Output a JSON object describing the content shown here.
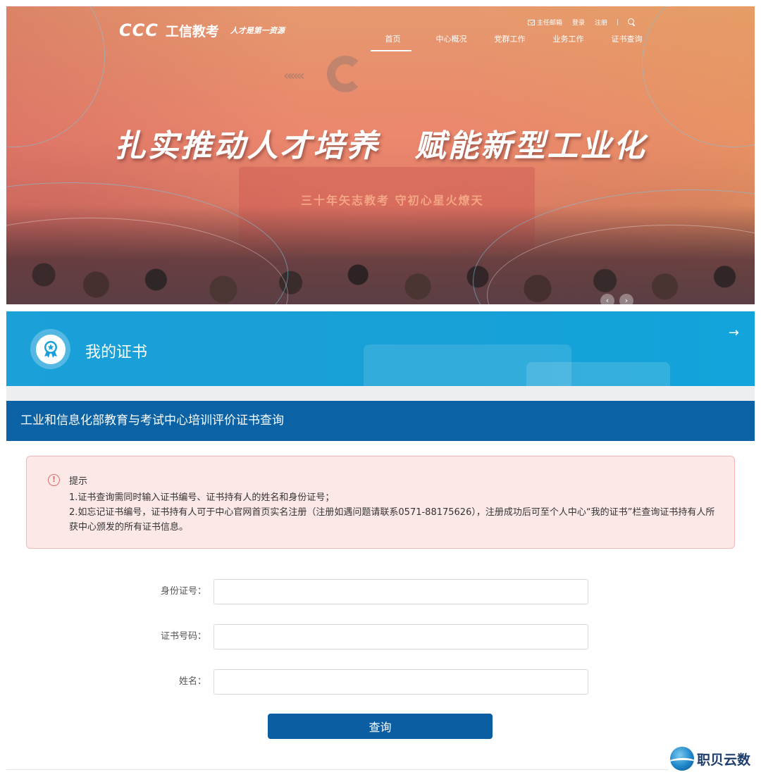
{
  "header": {
    "logo_mark": "CCC",
    "logo_name": "工信教考",
    "slogan": "人才是第一资源",
    "util": {
      "mailbox": "主任邮箱",
      "login": "登录",
      "register": "注册"
    },
    "nav": [
      {
        "label": "首页",
        "active": true
      },
      {
        "label": "中心概况"
      },
      {
        "label": "党群工作"
      },
      {
        "label": "业务工作"
      },
      {
        "label": "证书查询"
      }
    ]
  },
  "hero": {
    "headline_left": "扎实推动人才培养",
    "headline_right": "赋能新型工业化",
    "stage_text": "三十年矢志教考  守初心星火燎天"
  },
  "banner": {
    "title": "我的证书",
    "arrow": "→"
  },
  "section_title": "工业和信息化部教育与考试中心培训评价证书查询",
  "notice": {
    "title": "提示",
    "lines": [
      "1.证书查询需同时输入证书编号、证书持有人的姓名和身份证号；",
      "2.如忘记证书编号，证书持有人可于中心官网首页实名注册（注册如遇问题请联系0571-88175626），注册成功后可至个人中心“我的证书”栏查询证书持有人所获中心颁发的所有证书信息。"
    ]
  },
  "form": {
    "id_label": "身份证号：",
    "id_value": "",
    "cert_label": "证书号码：",
    "cert_value": "",
    "name_label": "姓名：",
    "name_value": "",
    "submit_label": "查询"
  },
  "watermark": {
    "text": "职贝云数"
  },
  "colors": {
    "banner_blue": "#1ba0d8",
    "title_bar_blue": "#0b63a5",
    "button_blue": "#0b5ea2",
    "notice_bg": "#fde8e8",
    "notice_border": "#f2b8b8"
  }
}
